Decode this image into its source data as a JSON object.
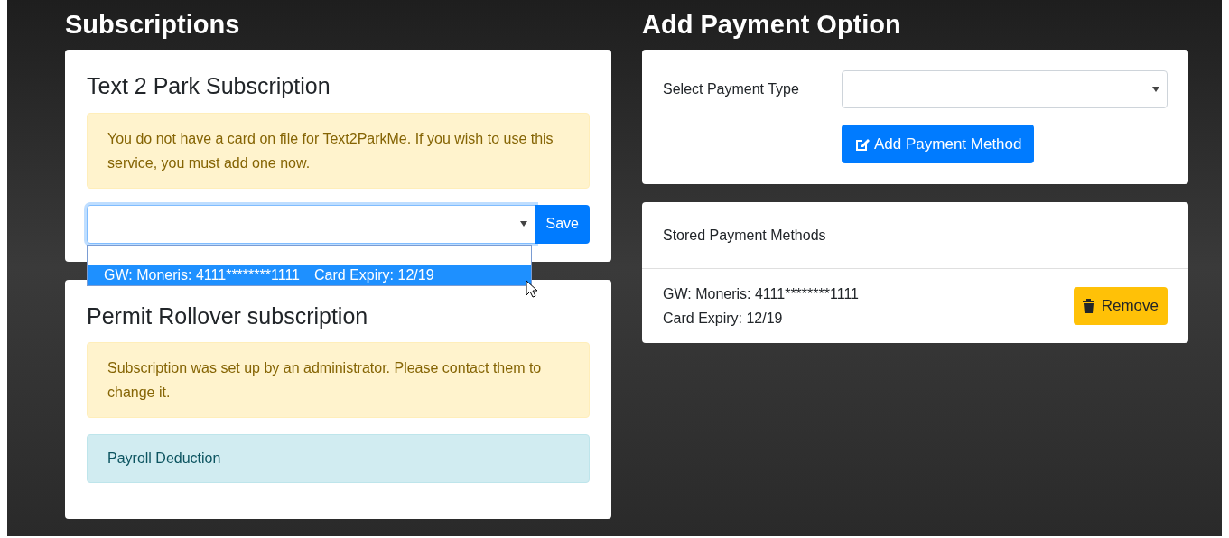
{
  "subscriptions": {
    "heading": "Subscriptions",
    "cards": [
      {
        "kind": "card_select",
        "title": "Text 2 Park Subscription",
        "alert": "You do not have a card on file for Text2ParkMe. If you wish to use this service, you must add one now.",
        "select": {
          "expanded": true,
          "options": [
            {
              "label": "GW: Moneris: 4111********1111",
              "detail": "Card Expiry: 12/19",
              "selected": true
            }
          ]
        },
        "button": "Save"
      },
      {
        "kind": "admin",
        "title": "Permit Rollover subscription",
        "alert": "Subscription was set up by an administrator. Please contact them to change it.",
        "info": "Payroll Deduction"
      }
    ]
  },
  "add_payment": {
    "heading": "Add Payment Option",
    "label": "Select Payment Type",
    "button": "Add Payment Method"
  },
  "stored": {
    "title": "Stored Payment Methods",
    "items": [
      {
        "gateway": "GW: Moneris: 4111********1111",
        "expiry": "Card Expiry: 12/19",
        "button": "Remove"
      }
    ]
  }
}
